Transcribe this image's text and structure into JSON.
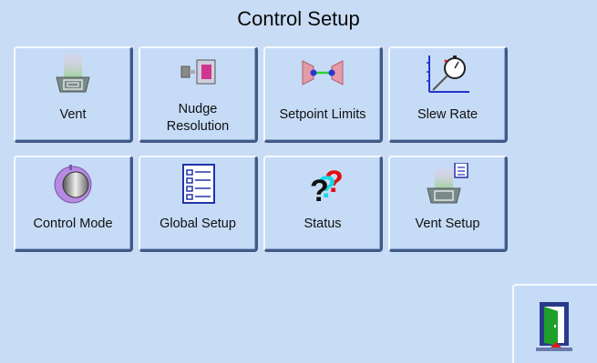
{
  "title": "Control Setup",
  "tiles": [
    {
      "label": "Vent",
      "icon": "vent-icon"
    },
    {
      "label": "Nudge Resolution",
      "line1": "Nudge",
      "line2": "Resolution",
      "icon": "nudge-icon"
    },
    {
      "label": "Setpoint Limits",
      "icon": "setpoint-limits-icon"
    },
    {
      "label": "Slew Rate",
      "icon": "stopwatch-icon"
    },
    {
      "label": "Control Mode",
      "icon": "knob-icon"
    },
    {
      "label": "Global Setup",
      "icon": "checklist-icon"
    },
    {
      "label": "Status",
      "icon": "question-marks-icon"
    },
    {
      "label": "Vent Setup",
      "icon": "vent-setup-icon"
    }
  ],
  "exit": {
    "icon": "exit-door-icon"
  }
}
